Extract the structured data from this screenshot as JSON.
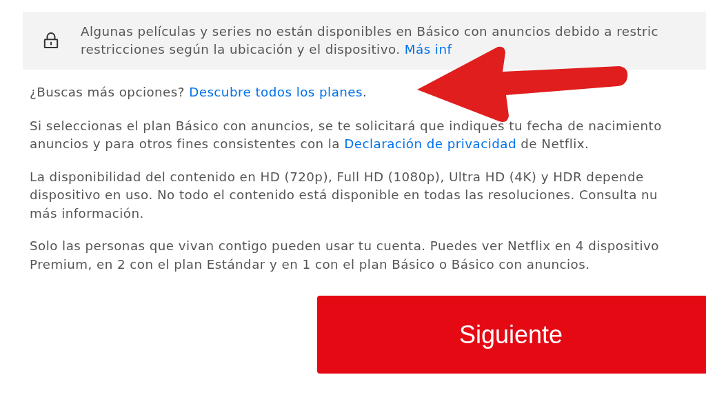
{
  "notice": {
    "lines": [
      [
        {
          "kind": "text",
          "text": "Algunas películas y series no están disponibles en Básico con anuncios debido a restric"
        }
      ],
      [
        {
          "kind": "text",
          "text": "restricciones según la ubicación y el dispositivo. "
        },
        {
          "kind": "link",
          "text": "Más inf"
        }
      ]
    ]
  },
  "paragraphs": [
    {
      "lines": [
        [
          {
            "kind": "text",
            "text": "¿Buscas más opciones? "
          },
          {
            "kind": "link",
            "text": "Descubre todos los planes"
          },
          {
            "kind": "text",
            "text": "."
          }
        ]
      ]
    },
    {
      "lines": [
        [
          {
            "kind": "text",
            "text": "Si seleccionas el plan Básico con anuncios, se te solicitará que indiques tu fecha de nacimiento"
          }
        ],
        [
          {
            "kind": "text",
            "text": "anuncios y para otros fines consistentes con la "
          },
          {
            "kind": "link",
            "text": "Declaración de privacidad"
          },
          {
            "kind": "text",
            "text": " de Netflix."
          }
        ]
      ]
    },
    {
      "lines": [
        [
          {
            "kind": "text",
            "text": "La disponibilidad del contenido en HD (720p), Full HD (1080p), Ultra HD (4K) y HDR depende"
          }
        ],
        [
          {
            "kind": "text",
            "text": "dispositivo en uso. No todo el contenido está disponible en todas las resoluciones. Consulta nu"
          }
        ],
        [
          {
            "kind": "text",
            "text": "más información."
          }
        ]
      ]
    },
    {
      "lines": [
        [
          {
            "kind": "text",
            "text": "Solo las personas que vivan contigo pueden usar tu cuenta. Puedes ver Netflix en 4 dispositivo"
          }
        ],
        [
          {
            "kind": "text",
            "text": "Premium, en 2 con el plan Estándar y en 1 con el plan Básico o Básico con anuncios."
          }
        ]
      ]
    }
  ],
  "next_button": {
    "label": "Siguiente"
  }
}
